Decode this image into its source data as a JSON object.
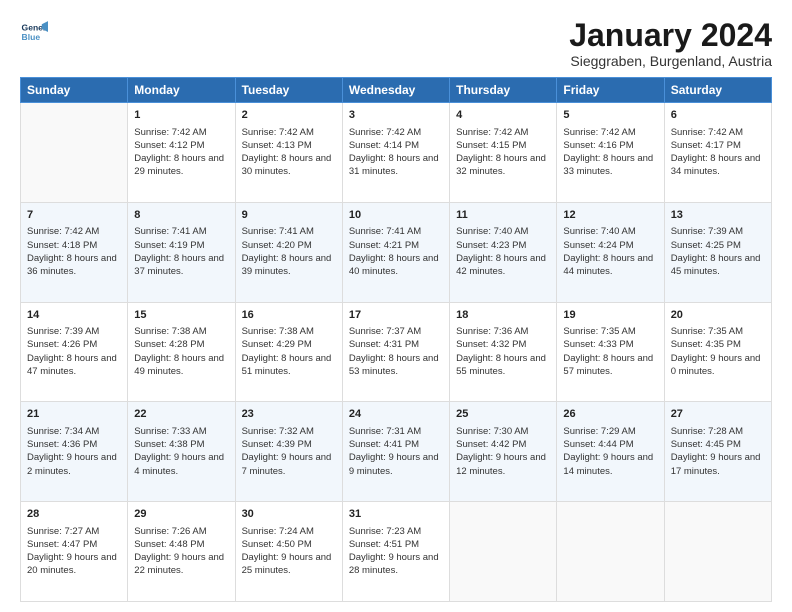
{
  "logo": {
    "line1": "General",
    "line2": "Blue"
  },
  "title": "January 2024",
  "subtitle": "Sieggraben, Burgenland, Austria",
  "columns": [
    "Sunday",
    "Monday",
    "Tuesday",
    "Wednesday",
    "Thursday",
    "Friday",
    "Saturday"
  ],
  "weeks": [
    [
      {
        "day": "",
        "sunrise": "",
        "sunset": "",
        "daylight": ""
      },
      {
        "day": "1",
        "sunrise": "Sunrise: 7:42 AM",
        "sunset": "Sunset: 4:12 PM",
        "daylight": "Daylight: 8 hours and 29 minutes."
      },
      {
        "day": "2",
        "sunrise": "Sunrise: 7:42 AM",
        "sunset": "Sunset: 4:13 PM",
        "daylight": "Daylight: 8 hours and 30 minutes."
      },
      {
        "day": "3",
        "sunrise": "Sunrise: 7:42 AM",
        "sunset": "Sunset: 4:14 PM",
        "daylight": "Daylight: 8 hours and 31 minutes."
      },
      {
        "day": "4",
        "sunrise": "Sunrise: 7:42 AM",
        "sunset": "Sunset: 4:15 PM",
        "daylight": "Daylight: 8 hours and 32 minutes."
      },
      {
        "day": "5",
        "sunrise": "Sunrise: 7:42 AM",
        "sunset": "Sunset: 4:16 PM",
        "daylight": "Daylight: 8 hours and 33 minutes."
      },
      {
        "day": "6",
        "sunrise": "Sunrise: 7:42 AM",
        "sunset": "Sunset: 4:17 PM",
        "daylight": "Daylight: 8 hours and 34 minutes."
      }
    ],
    [
      {
        "day": "7",
        "sunrise": "Sunrise: 7:42 AM",
        "sunset": "Sunset: 4:18 PM",
        "daylight": "Daylight: 8 hours and 36 minutes."
      },
      {
        "day": "8",
        "sunrise": "Sunrise: 7:41 AM",
        "sunset": "Sunset: 4:19 PM",
        "daylight": "Daylight: 8 hours and 37 minutes."
      },
      {
        "day": "9",
        "sunrise": "Sunrise: 7:41 AM",
        "sunset": "Sunset: 4:20 PM",
        "daylight": "Daylight: 8 hours and 39 minutes."
      },
      {
        "day": "10",
        "sunrise": "Sunrise: 7:41 AM",
        "sunset": "Sunset: 4:21 PM",
        "daylight": "Daylight: 8 hours and 40 minutes."
      },
      {
        "day": "11",
        "sunrise": "Sunrise: 7:40 AM",
        "sunset": "Sunset: 4:23 PM",
        "daylight": "Daylight: 8 hours and 42 minutes."
      },
      {
        "day": "12",
        "sunrise": "Sunrise: 7:40 AM",
        "sunset": "Sunset: 4:24 PM",
        "daylight": "Daylight: 8 hours and 44 minutes."
      },
      {
        "day": "13",
        "sunrise": "Sunrise: 7:39 AM",
        "sunset": "Sunset: 4:25 PM",
        "daylight": "Daylight: 8 hours and 45 minutes."
      }
    ],
    [
      {
        "day": "14",
        "sunrise": "Sunrise: 7:39 AM",
        "sunset": "Sunset: 4:26 PM",
        "daylight": "Daylight: 8 hours and 47 minutes."
      },
      {
        "day": "15",
        "sunrise": "Sunrise: 7:38 AM",
        "sunset": "Sunset: 4:28 PM",
        "daylight": "Daylight: 8 hours and 49 minutes."
      },
      {
        "day": "16",
        "sunrise": "Sunrise: 7:38 AM",
        "sunset": "Sunset: 4:29 PM",
        "daylight": "Daylight: 8 hours and 51 minutes."
      },
      {
        "day": "17",
        "sunrise": "Sunrise: 7:37 AM",
        "sunset": "Sunset: 4:31 PM",
        "daylight": "Daylight: 8 hours and 53 minutes."
      },
      {
        "day": "18",
        "sunrise": "Sunrise: 7:36 AM",
        "sunset": "Sunset: 4:32 PM",
        "daylight": "Daylight: 8 hours and 55 minutes."
      },
      {
        "day": "19",
        "sunrise": "Sunrise: 7:35 AM",
        "sunset": "Sunset: 4:33 PM",
        "daylight": "Daylight: 8 hours and 57 minutes."
      },
      {
        "day": "20",
        "sunrise": "Sunrise: 7:35 AM",
        "sunset": "Sunset: 4:35 PM",
        "daylight": "Daylight: 9 hours and 0 minutes."
      }
    ],
    [
      {
        "day": "21",
        "sunrise": "Sunrise: 7:34 AM",
        "sunset": "Sunset: 4:36 PM",
        "daylight": "Daylight: 9 hours and 2 minutes."
      },
      {
        "day": "22",
        "sunrise": "Sunrise: 7:33 AM",
        "sunset": "Sunset: 4:38 PM",
        "daylight": "Daylight: 9 hours and 4 minutes."
      },
      {
        "day": "23",
        "sunrise": "Sunrise: 7:32 AM",
        "sunset": "Sunset: 4:39 PM",
        "daylight": "Daylight: 9 hours and 7 minutes."
      },
      {
        "day": "24",
        "sunrise": "Sunrise: 7:31 AM",
        "sunset": "Sunset: 4:41 PM",
        "daylight": "Daylight: 9 hours and 9 minutes."
      },
      {
        "day": "25",
        "sunrise": "Sunrise: 7:30 AM",
        "sunset": "Sunset: 4:42 PM",
        "daylight": "Daylight: 9 hours and 12 minutes."
      },
      {
        "day": "26",
        "sunrise": "Sunrise: 7:29 AM",
        "sunset": "Sunset: 4:44 PM",
        "daylight": "Daylight: 9 hours and 14 minutes."
      },
      {
        "day": "27",
        "sunrise": "Sunrise: 7:28 AM",
        "sunset": "Sunset: 4:45 PM",
        "daylight": "Daylight: 9 hours and 17 minutes."
      }
    ],
    [
      {
        "day": "28",
        "sunrise": "Sunrise: 7:27 AM",
        "sunset": "Sunset: 4:47 PM",
        "daylight": "Daylight: 9 hours and 20 minutes."
      },
      {
        "day": "29",
        "sunrise": "Sunrise: 7:26 AM",
        "sunset": "Sunset: 4:48 PM",
        "daylight": "Daylight: 9 hours and 22 minutes."
      },
      {
        "day": "30",
        "sunrise": "Sunrise: 7:24 AM",
        "sunset": "Sunset: 4:50 PM",
        "daylight": "Daylight: 9 hours and 25 minutes."
      },
      {
        "day": "31",
        "sunrise": "Sunrise: 7:23 AM",
        "sunset": "Sunset: 4:51 PM",
        "daylight": "Daylight: 9 hours and 28 minutes."
      },
      {
        "day": "",
        "sunrise": "",
        "sunset": "",
        "daylight": ""
      },
      {
        "day": "",
        "sunrise": "",
        "sunset": "",
        "daylight": ""
      },
      {
        "day": "",
        "sunrise": "",
        "sunset": "",
        "daylight": ""
      }
    ]
  ]
}
